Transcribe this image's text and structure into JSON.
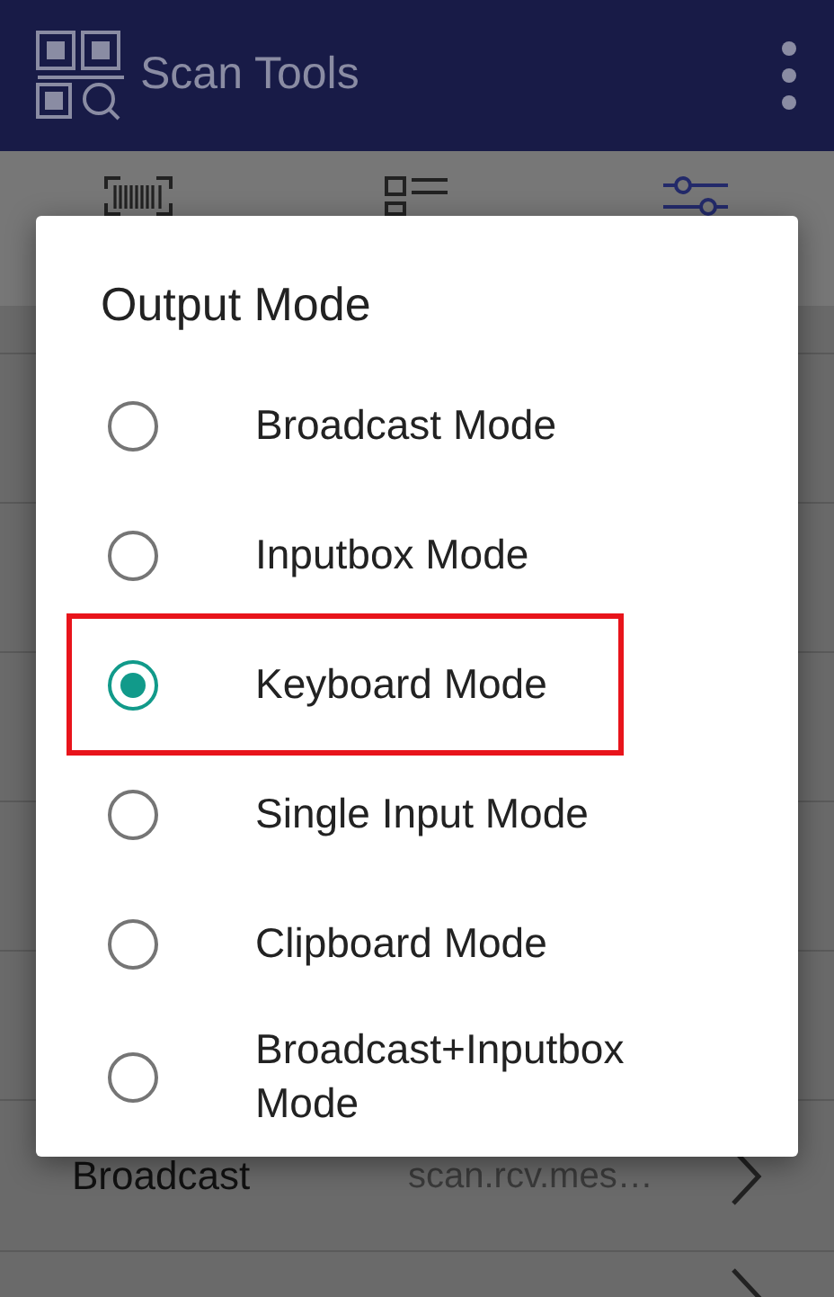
{
  "app_bar": {
    "title": "Scan Tools"
  },
  "tabs": [
    {
      "selected": false
    },
    {
      "selected": false
    },
    {
      "selected": true
    }
  ],
  "settings_rows": [
    {
      "label": "Broadcast",
      "value": "scan.rcv.mes…"
    }
  ],
  "more_rows_below": true,
  "dialog": {
    "title": "Output Mode",
    "options": [
      {
        "label": "Broadcast Mode",
        "selected": false,
        "highlighted": false
      },
      {
        "label": "Inputbox Mode",
        "selected": false,
        "highlighted": false
      },
      {
        "label": "Keyboard Mode",
        "selected": true,
        "highlighted": true
      },
      {
        "label": "Single Input Mode",
        "selected": false,
        "highlighted": false
      },
      {
        "label": "Clipboard Mode",
        "selected": false,
        "highlighted": false
      },
      {
        "label": "Broadcast+Inputbox Mode",
        "selected": false,
        "highlighted": false
      }
    ]
  }
}
